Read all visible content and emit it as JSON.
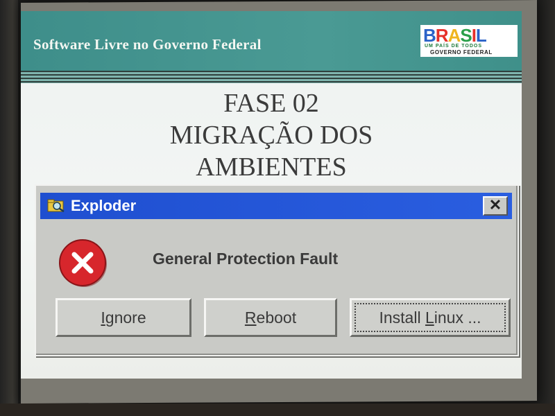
{
  "slide": {
    "banner_title": "Software Livre no Governo Federal",
    "logo": {
      "word": [
        "B",
        "R",
        "A",
        "S",
        "I",
        "L"
      ],
      "tagline": "UM PAÍS DE TODOS",
      "subtitle": "GOVERNO FEDERAL"
    },
    "title_lines": [
      "FASE 02",
      "MIGRAÇÃO DOS",
      "AMBIENTES"
    ]
  },
  "dialog": {
    "title": "Exploder",
    "close_label": "✕",
    "message": "General Protection Fault",
    "buttons": {
      "ignore": {
        "accel": "I",
        "rest": "gnore"
      },
      "reboot": {
        "accel": "R",
        "rest": "eboot"
      },
      "install_linux": {
        "pre": "Install ",
        "accel": "L",
        "rest": "inux ..."
      }
    }
  },
  "icons": {
    "title_icon": "folder-magnifier-icon",
    "error_icon": "error-x-icon",
    "close_icon": "close-icon"
  },
  "colors": {
    "banner": "#4a9a94",
    "titlebar": "#2a5ee0",
    "dialog_face": "#c9cac6",
    "error_red": "#d7262c"
  }
}
